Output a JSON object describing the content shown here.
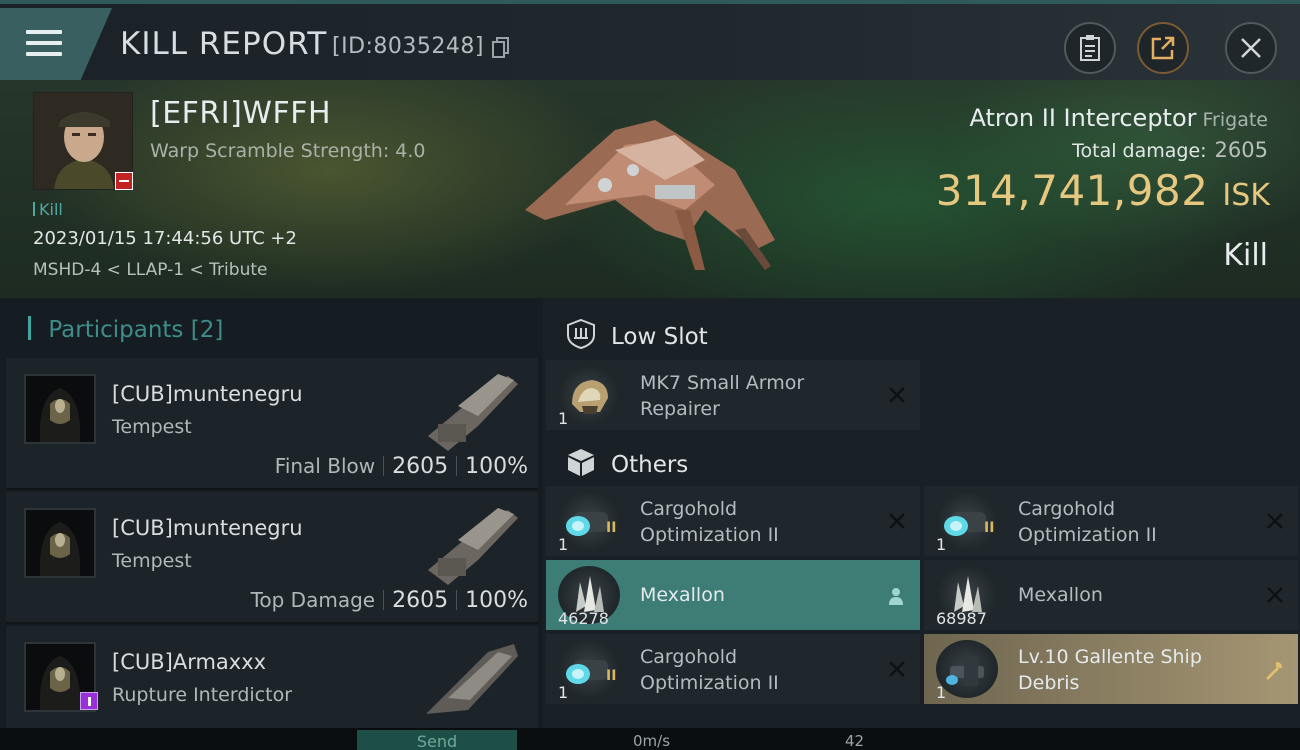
{
  "header": {
    "title": "KILL REPORT",
    "report_id": "[ID:8035248]",
    "icons": [
      "menu-icon",
      "copy-icon",
      "clipboard-icon",
      "share-icon",
      "close-icon"
    ]
  },
  "victim": {
    "name": "[EFRI]WFFH",
    "warp_scramble": "Warp Scramble Strength: 4.0",
    "tag": "Kill",
    "datetime": "2023/01/15 17:44:56 UTC +2",
    "location": "MSHD-4 < LLAP-1 < Tribute",
    "ship_name": "Atron II Interceptor",
    "ship_class": "Frigate",
    "total_damage_label": "Total damage:",
    "total_damage": "2605",
    "isk_value": "314,741,982",
    "isk_unit": "ISK",
    "result": "Kill"
  },
  "participants": {
    "label": "Participants",
    "count": "[2]",
    "rows": [
      {
        "name": "[CUB]muntenegru",
        "ship": "Tempest",
        "role": "Final Blow",
        "damage": "2605",
        "percent": "100%"
      },
      {
        "name": "[CUB]muntenegru",
        "ship": "Tempest",
        "role": "Top Damage",
        "damage": "2605",
        "percent": "100%"
      },
      {
        "name": "[CUB]Armaxxx",
        "ship": "Rupture Interdictor"
      }
    ]
  },
  "low_slot": {
    "label": "Low Slot",
    "items": [
      {
        "name_line1": "MK7 Small Armor",
        "name_line2": "Repairer",
        "qty": "1"
      }
    ]
  },
  "others": {
    "label": "Others",
    "items": [
      {
        "name_line1": "Cargohold",
        "name_line2": "Optimization II",
        "qty": "1",
        "tier": "II"
      },
      {
        "name_line1": "Cargohold",
        "name_line2": "Optimization II",
        "qty": "1",
        "tier": "II"
      },
      {
        "name": "Mexallon",
        "qty": "46278"
      },
      {
        "name": "Mexallon",
        "qty": "68987"
      },
      {
        "name_line1": "Cargohold",
        "name_line2": "Optimization II",
        "qty": "1",
        "tier": "II"
      },
      {
        "name_line1": "Lv.10 Gallente Ship",
        "name_line2": "Debris",
        "qty": "1"
      }
    ]
  },
  "bottom": {
    "send": "Send",
    "speed": "0m/s",
    "count": "42"
  },
  "colors": {
    "accent_teal": "#3fa6a0",
    "isk_gold": "#e5c77f",
    "highlight_row": "#3d7d76",
    "debris_gold": "#a59673"
  }
}
